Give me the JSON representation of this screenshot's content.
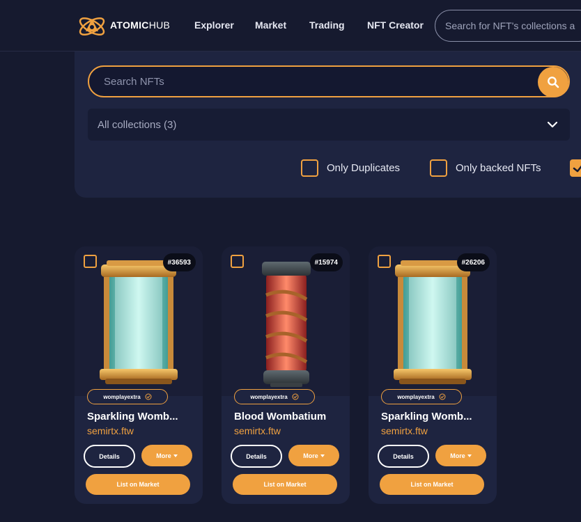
{
  "header": {
    "logo_bold": "ATOMIC",
    "logo_light": "HUB",
    "nav": [
      "Explorer",
      "Market",
      "Trading",
      "NFT Creator"
    ],
    "search_placeholder": "Search for NFT's collections a"
  },
  "filters": {
    "search_placeholder": "Search NFTs",
    "collections_label": "All collections (3)",
    "checkbox_options": [
      {
        "label": "Only Duplicates",
        "checked": false
      },
      {
        "label": "Only backed NFTs",
        "checked": false
      },
      {
        "label": "",
        "checked": true
      }
    ]
  },
  "cards": [
    {
      "id": "#36593",
      "collection": "womplayextra",
      "name": "Sparkling Womb...",
      "owner": "semirtx.ftw",
      "details_label": "Details",
      "more_label": "More",
      "list_label": "List on Market",
      "image": "sparkling-wombatium-capsule"
    },
    {
      "id": "#15974",
      "collection": "womplayextra",
      "name": "Blood Wombatium",
      "owner": "semirtx.ftw",
      "details_label": "Details",
      "more_label": "More",
      "list_label": "List on Market",
      "image": "blood-wombatium-capsule"
    },
    {
      "id": "#26206",
      "collection": "womplayextra",
      "name": "Sparkling Womb...",
      "owner": "semirtx.ftw",
      "details_label": "Details",
      "more_label": "More",
      "list_label": "List on Market",
      "image": "sparkling-wombatium-capsule"
    }
  ],
  "colors": {
    "accent": "#f0a140",
    "background": "#161a2f",
    "panel": "#1e2440"
  }
}
